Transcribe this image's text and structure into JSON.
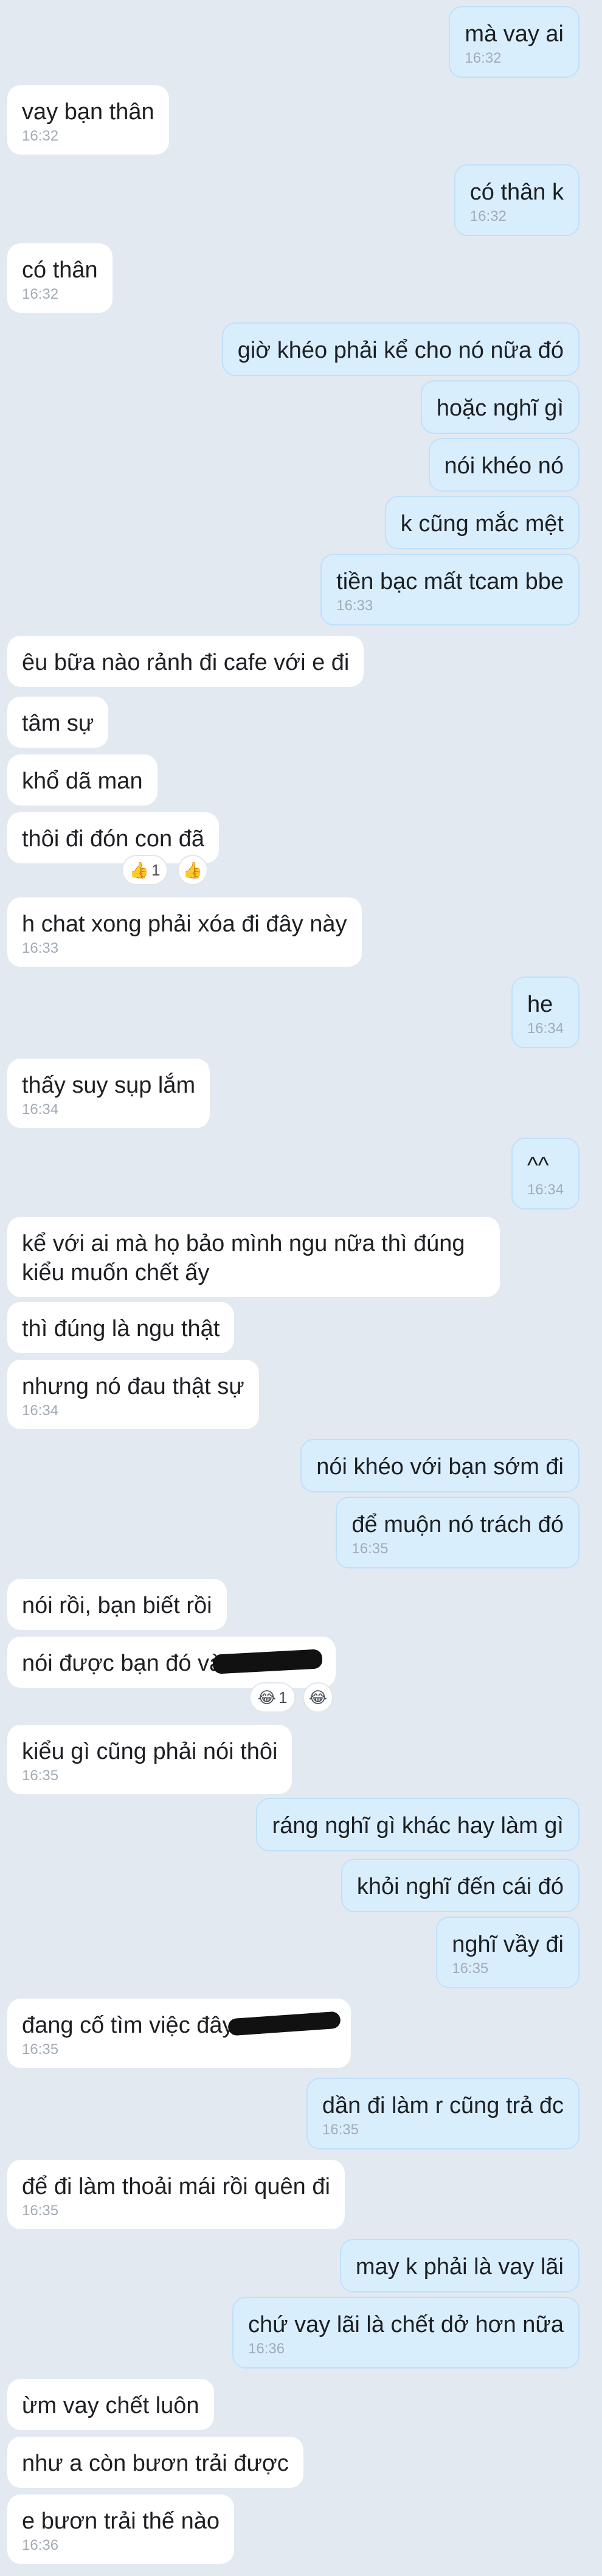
{
  "messages": [
    {
      "text": "mà vay ai",
      "time": "16:32"
    },
    {
      "text": "vay bạn thân",
      "time": "16:32"
    },
    {
      "text": "có thân k",
      "time": "16:32"
    },
    {
      "text": "có thân",
      "time": "16:32"
    },
    {
      "text": "giờ khéo phải kể cho nó nữa đó",
      "time": ""
    },
    {
      "text": "hoặc nghĩ gì",
      "time": ""
    },
    {
      "text": "nói khéo nó",
      "time": ""
    },
    {
      "text": "k cũng mắc mệt",
      "time": ""
    },
    {
      "text": "tiền bạc mất tcam bbe",
      "time": "16:33"
    },
    {
      "text": "êu bữa nào rảnh đi cafe với e đi",
      "time": ""
    },
    {
      "text": "tâm sự",
      "time": ""
    },
    {
      "text": "khổ dã man",
      "time": ""
    },
    {
      "text": "thôi đi đón con đã",
      "time": ""
    },
    {
      "text": "h chat xong phải xóa đi đây này",
      "time": "16:33"
    },
    {
      "text": "he",
      "time": "16:34"
    },
    {
      "text": "thấy suy sụp lắm",
      "time": "16:34"
    },
    {
      "text": "^^",
      "time": "16:34"
    },
    {
      "text": "kể với ai mà họ bảo mình ngu nữa thì đúng kiểu muốn chết ấy",
      "time": ""
    },
    {
      "text": "thì đúng là ngu thật",
      "time": ""
    },
    {
      "text": "nhưng nó đau thật sự",
      "time": "16:34"
    },
    {
      "text": "nói khéo với bạn sớm đi",
      "time": ""
    },
    {
      "text": "để muộn nó trách đó",
      "time": "16:35"
    },
    {
      "text": "nói rồi, bạn biết rồi",
      "time": ""
    },
    {
      "text": "nói được bạn đó và",
      "time": ""
    },
    {
      "text": "kiểu gì cũng phải nói thôi",
      "time": "16:35"
    },
    {
      "text": "ráng nghĩ gì khác hay làm gì",
      "time": ""
    },
    {
      "text": "khỏi nghĩ đến cái đó",
      "time": ""
    },
    {
      "text": "nghĩ vầy đi",
      "time": "16:35"
    },
    {
      "text": "đang cố tìm việc đây",
      "time": "16:35"
    },
    {
      "text": "dần đi làm r cũng trả đc",
      "time": "16:35"
    },
    {
      "text": "để đi làm thoải mái rồi quên đi",
      "time": "16:35"
    },
    {
      "text": "may k phải là vay lãi",
      "time": ""
    },
    {
      "text": "chứ vay lãi là chết dở hơn nữa",
      "time": "16:36"
    },
    {
      "text": "ừm vay chết luôn",
      "time": ""
    },
    {
      "text": "như a còn bươn trải được",
      "time": ""
    },
    {
      "text": "e bươn trải thế nào",
      "time": "16:36"
    }
  ],
  "reactions": [
    {
      "emoji": "👍",
      "count": "1"
    },
    {
      "emoji": "👍",
      "count": ""
    },
    {
      "emoji": "😂",
      "count": "1"
    },
    {
      "emoji": "😂",
      "count": ""
    }
  ]
}
